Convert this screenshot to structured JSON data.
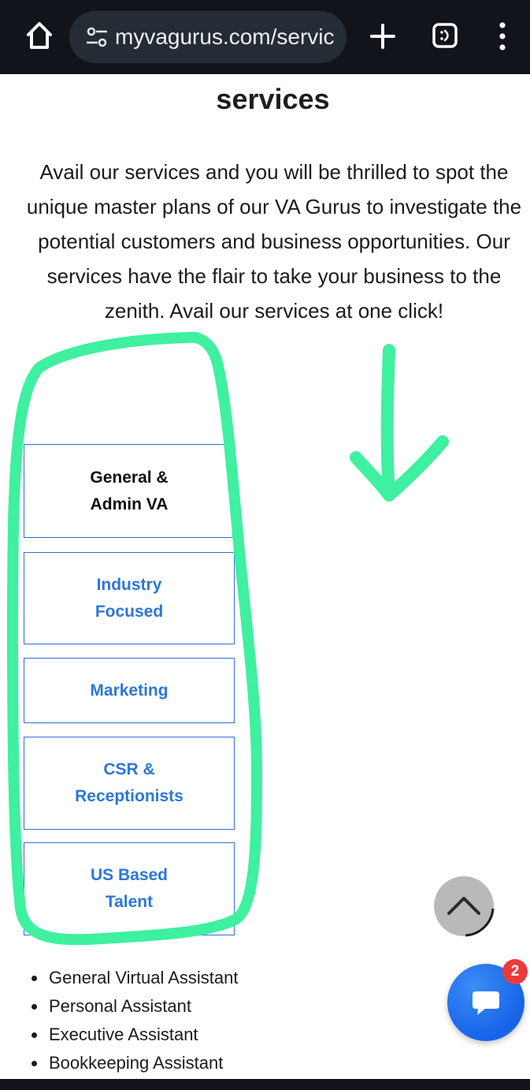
{
  "browser": {
    "url": "myvagurus.com/servic",
    "colors": {
      "toolbar_bg": "#11151b",
      "urlbar_bg": "#262c35"
    }
  },
  "page": {
    "heading": "services",
    "intro": "Avail our services and you will be thrilled to spot the unique master plans of our VA Gurus to investigate the potential customers and business opportunities. Our services have the flair to take your business to the zenith. Avail our services at one click!",
    "tabs": [
      {
        "label_line1": "General &",
        "label_line2": "Admin VA",
        "active": true
      },
      {
        "label_line1": "Industry",
        "label_line2": "Focused",
        "active": false
      },
      {
        "label_line1": "Marketing",
        "label_line2": "",
        "active": false
      },
      {
        "label_line1": "CSR &",
        "label_line2": "Receptionists",
        "active": false
      },
      {
        "label_line1": "US Based",
        "label_line2": "Talent",
        "active": false
      }
    ],
    "services_list": [
      "General Virtual Assistant",
      "Personal Assistant",
      "Executive Assistant",
      "Bookkeeping Assistant"
    ]
  },
  "chat": {
    "badge_count": "2"
  },
  "colors": {
    "tab_link": "#2b76d9",
    "tab_border": "#2f6fd6",
    "annotation": "#3ef0a0",
    "chat_button": "#1664e8",
    "badge": "#ec3b3b"
  }
}
